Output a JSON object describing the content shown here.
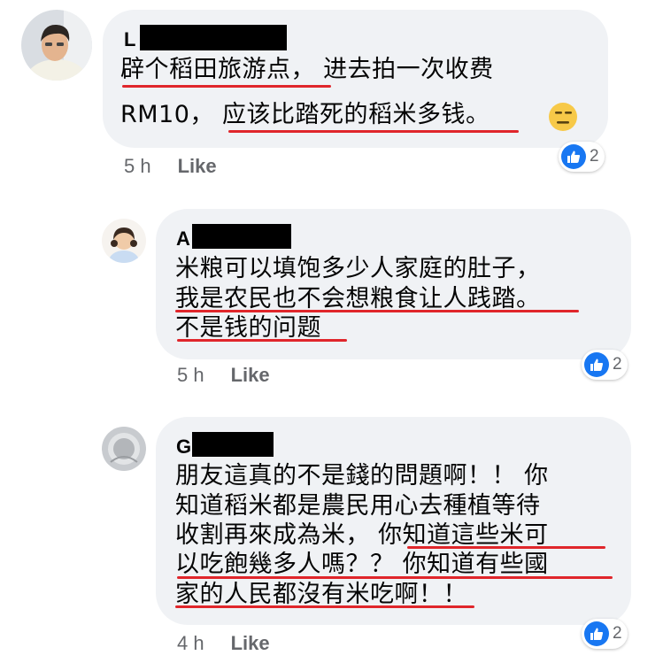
{
  "comments": [
    {
      "author": "L",
      "lines": [
        "辟个稻田旅游点， 进去拍一次收费",
        "RM10， 应该比踏死的稻米多钱。"
      ],
      "emoji": "expressionless-face",
      "time": "5 h",
      "like_label": "Like",
      "reaction_count": "2"
    },
    {
      "author": "A",
      "lines": [
        "米粮可以填饱多少人家庭的肚子，",
        "我是农民也不会想粮食让人践踏。",
        "不是钱的问题"
      ],
      "time": "5 h",
      "like_label": "Like",
      "reaction_count": "2"
    },
    {
      "author": "G",
      "lines": [
        "朋友這真的不是錢的問題啊！！ 你",
        "知道稻米都是農民用心去種植等待",
        "收割再來成為米， 你知道這些米可",
        "以吃飽幾多人嗎？？ 你知道有些國",
        "家的人民都沒有米吃啊！！"
      ],
      "time": "4 h",
      "like_label": "Like",
      "reaction_count": "2"
    }
  ],
  "colors": {
    "bubble": "#f0f2f5",
    "underline": "#e0262b",
    "like_blue": "#1877f2",
    "meta_gray": "#65676b"
  }
}
